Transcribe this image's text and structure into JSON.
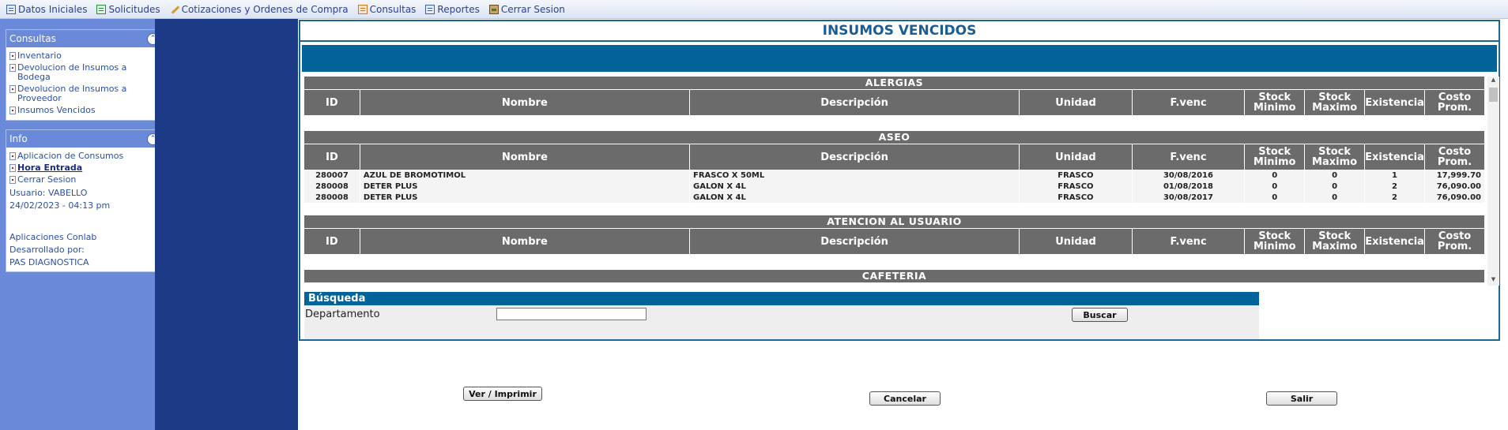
{
  "menu": [
    {
      "label": "Datos Iniciales",
      "icon": "document-list-icon"
    },
    {
      "label": "Solicitudes",
      "icon": "spreadsheet-icon"
    },
    {
      "label": "Cotizaciones y Ordenes de Compra",
      "icon": "pencil-icon"
    },
    {
      "label": "Consultas",
      "icon": "calendar-icon"
    },
    {
      "label": "Reportes",
      "icon": "report-icon"
    },
    {
      "label": "Cerrar Sesion",
      "icon": "exit-door-icon"
    }
  ],
  "sidebar": {
    "consultas": {
      "title": "Consultas",
      "items": [
        "Inventario",
        "Devolucion de Insumos a Bodega",
        "Devolucion de Insumos a Proveedor",
        "Insumos Vencidos"
      ]
    },
    "info": {
      "title": "Info",
      "items": [
        "Aplicacion de Consumos",
        "Hora Entrada",
        "Cerrar Sesion"
      ],
      "user": "Usuario: VABELLO",
      "datetime": "24/02/2023 - 04:13 pm",
      "app": "Aplicaciones Conlab",
      "dev_label": "Desarrollado por:",
      "dev_name": "PAS DIAGNOSTICA"
    }
  },
  "page": {
    "title": "INSUMOS VENCIDOS"
  },
  "columns": [
    "ID",
    "Nombre",
    "Descripción",
    "Unidad",
    "F.venc",
    "Stock Minimo",
    "Stock Maximo",
    "Existencia",
    "Costo Prom."
  ],
  "categories": [
    {
      "name": "ALERGIAS",
      "rows": []
    },
    {
      "name": "ASEO",
      "rows": [
        {
          "id": "280007",
          "nombre": "AZUL DE BROMOTIMOL",
          "descripcion": "FRASCO X 50ML",
          "unidad": "FRASCO",
          "fvenc": "30/08/2016",
          "min": "0",
          "max": "0",
          "existencia": "1",
          "costo": "17,999.70"
        },
        {
          "id": "280008",
          "nombre": "DETER PLUS",
          "descripcion": "GALON X 4L",
          "unidad": "FRASCO",
          "fvenc": "01/08/2018",
          "min": "0",
          "max": "0",
          "existencia": "2",
          "costo": "76,090.00"
        },
        {
          "id": "280008",
          "nombre": "DETER PLUS",
          "descripcion": "GALON X 4L",
          "unidad": "FRASCO",
          "fvenc": "30/08/2017",
          "min": "0",
          "max": "0",
          "existencia": "2",
          "costo": "76,090.00"
        }
      ]
    },
    {
      "name": "ATENCION AL USUARIO",
      "rows": []
    },
    {
      "name": "CAFETERIA",
      "rows": []
    }
  ],
  "search": {
    "title": "Búsqueda",
    "field_label": "Departamento",
    "field_value": "",
    "button": "Buscar"
  },
  "buttons": {
    "ver": "Ver / Imprimir",
    "cancelar": "Cancelar",
    "salir": "Salir"
  }
}
